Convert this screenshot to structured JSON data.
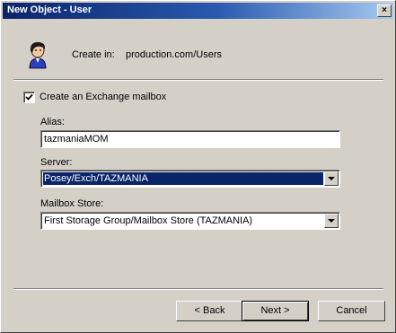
{
  "window": {
    "title": "New Object - User",
    "close_glyph": "×"
  },
  "header": {
    "create_in_label": "Create in:",
    "create_in_value": "production.com/Users",
    "icon": "user-icon"
  },
  "options": {
    "create_mailbox_label": "Create an Exchange mailbox",
    "create_mailbox_checked": true
  },
  "fields": {
    "alias_label": "Alias:",
    "alias_value": "tazmaniaMOM",
    "server_label": "Server:",
    "server_value": "Posey/Exch/TAZMANIA",
    "mailbox_store_label": "Mailbox Store:",
    "mailbox_store_value": "First Storage Group/Mailbox Store (TAZMANIA)"
  },
  "buttons": {
    "back": "< Back",
    "next": "Next >",
    "cancel": "Cancel"
  },
  "colors": {
    "title_bar": "#0a246a",
    "selection": "#0a246a",
    "face": "#d4d0c8"
  }
}
